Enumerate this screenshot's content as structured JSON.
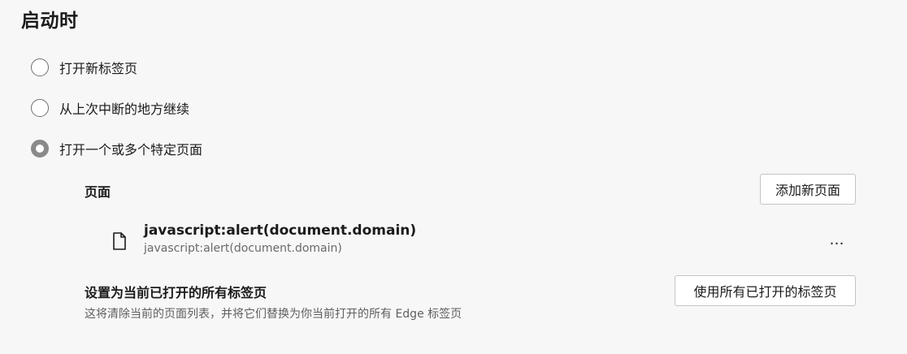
{
  "section_title": "启动时",
  "startup_options": [
    {
      "label": "打开新标签页",
      "checked": false
    },
    {
      "label": "从上次中断的地方继续",
      "checked": false
    },
    {
      "label": "打开一个或多个特定页面",
      "checked": true
    }
  ],
  "pages": {
    "heading": "页面",
    "add_button": "添加新页面",
    "entries": [
      {
        "title": "javascript:alert(document.domain)",
        "url": "javascript:alert(document.domain)",
        "icon": "document-icon",
        "more": "…"
      }
    ]
  },
  "set_current": {
    "heading": "设置为当前已打开的所有标签页",
    "description": "这将清除当前的页面列表，并将它们替换为你当前打开的所有 Edge 标签页",
    "button": "使用所有已打开的标签页"
  },
  "colors": {
    "background": "#f7f7f7",
    "radio_checked": "#8a8a8a",
    "button_border": "#c4c4c4"
  }
}
